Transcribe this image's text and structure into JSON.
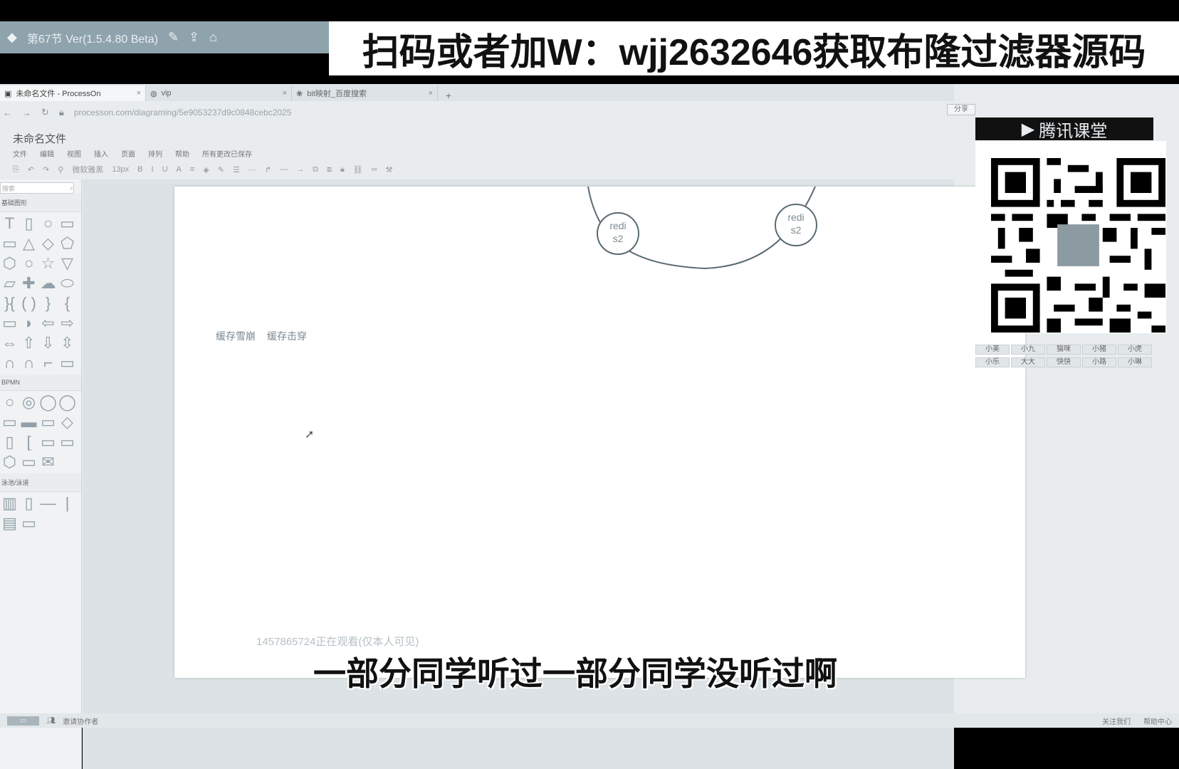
{
  "player": {
    "title": "第67节 Ver(1.5.4.80 Beta)"
  },
  "watermark": "扫码或者加W：wjj2632646获取布隆过滤器源码",
  "browser": {
    "tabs": [
      {
        "label": "未命名文件 - ProcessOn"
      },
      {
        "label": "vip"
      },
      {
        "label": "bit映射_百度搜索"
      }
    ],
    "url": "processon.com/diagraming/5e9053237d9c0848cebc2025"
  },
  "app": {
    "file_title": "未命名文件",
    "menu": [
      "文件",
      "编辑",
      "视图",
      "插入",
      "页面",
      "排列",
      "帮助",
      "所有更改已保存"
    ],
    "toolbar_font": "微软雅黑",
    "toolbar_size": "13px"
  },
  "palette": {
    "search_placeholder": "搜索",
    "sections": [
      "基础图形",
      "BPMN",
      "泳池/泳道"
    ]
  },
  "canvas": {
    "labels": [
      "缓存雪崩",
      "缓存击穿"
    ],
    "nodes": [
      {
        "text_line1": "redi",
        "text_line2": "s2"
      },
      {
        "text_line1": "redi",
        "text_line2": "s2"
      }
    ]
  },
  "overlay": {
    "viewer_note": "1457865724正在观看(仅本人可见)",
    "subtitle": "一部分同学听过一部分同学没听过啊"
  },
  "right_panel": {
    "brand": "腾讯课堂",
    "share_button": "分享",
    "users": [
      "小美",
      "小九",
      "猫咪",
      "小猪",
      "小虎",
      "小乐",
      "大大",
      "快快",
      "小路",
      "小琳"
    ]
  },
  "status_bar": {
    "left": "邀请协作者",
    "right": [
      "关注我们",
      "帮助中心"
    ]
  }
}
